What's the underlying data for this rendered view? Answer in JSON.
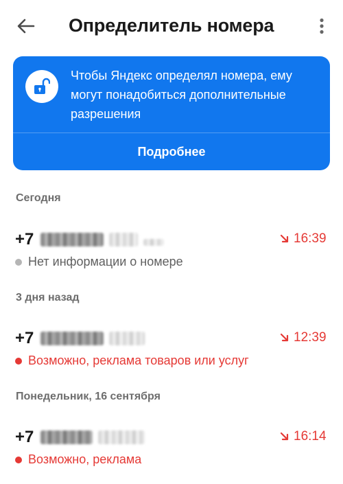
{
  "header": {
    "title": "Определитель номера",
    "back_icon": "arrow-left-icon",
    "menu_icon": "more-vertical-icon"
  },
  "banner": {
    "icon": "unlock-icon",
    "text": "Чтобы Яндекс определял номера, ему могут понадобиться дополнительные разрешения",
    "button_label": "Подробнее",
    "background_color": "#1177ee"
  },
  "sections": [
    {
      "label": "Сегодня",
      "calls": [
        {
          "number_prefix": "+7",
          "time": "16:39",
          "direction_icon": "incoming-call-arrow-icon",
          "status": "Нет информации о номере",
          "status_kind": "neutral"
        }
      ]
    },
    {
      "label": "3 дня назад",
      "calls": [
        {
          "number_prefix": "+7",
          "time": "12:39",
          "direction_icon": "incoming-call-arrow-icon",
          "status": "Возможно, реклама товаров или услуг",
          "status_kind": "warning"
        }
      ]
    },
    {
      "label": "Понедельник, 16 сентября",
      "calls": [
        {
          "number_prefix": "+7",
          "time": "16:14",
          "direction_icon": "incoming-call-arrow-icon",
          "status": "Возможно, реклама",
          "status_kind": "warning"
        }
      ]
    }
  ],
  "colors": {
    "warning": "#e53935",
    "neutral_dot": "#b5b5b5",
    "section_header": "#6d6d6d"
  }
}
